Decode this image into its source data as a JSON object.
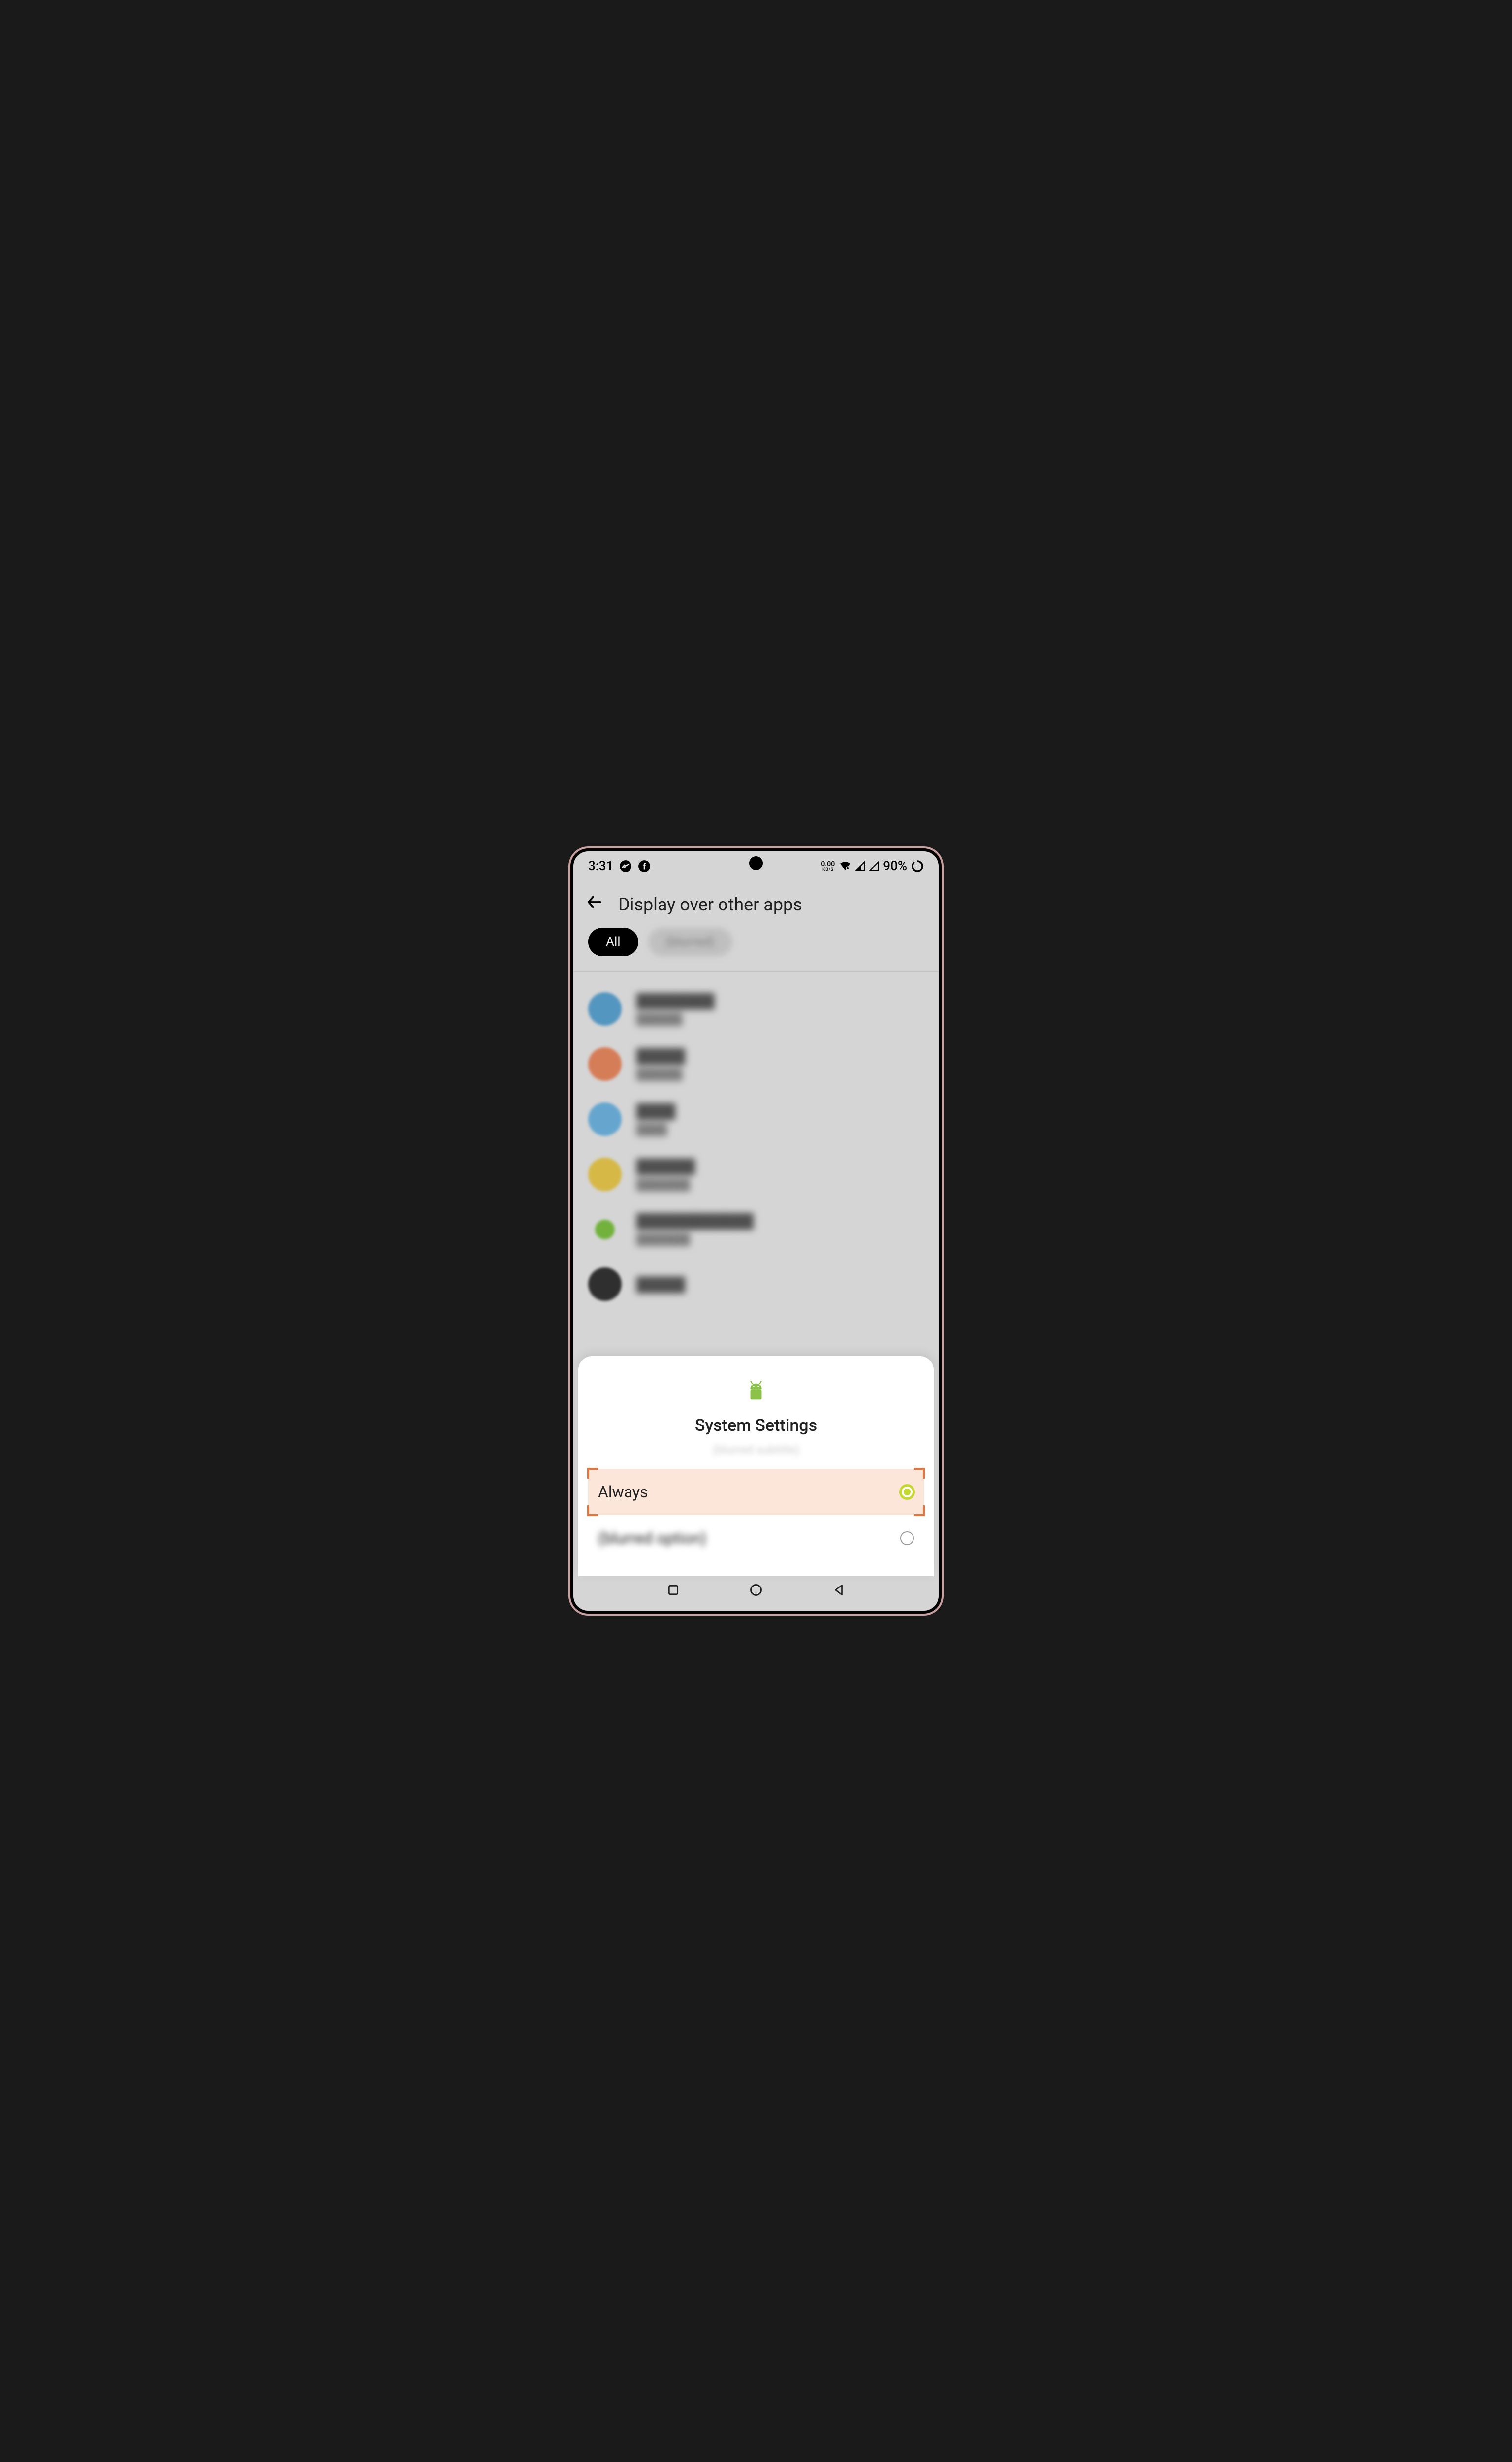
{
  "status": {
    "time": "3:31",
    "data_top": "0.00",
    "data_bottom": "KB/S",
    "battery_pct": "90%"
  },
  "header": {
    "title": "Display over other apps"
  },
  "chips": {
    "all": "All",
    "other": "(blurred)"
  },
  "sheet": {
    "title": "System Settings",
    "subtitle": "(blurred subtitle)",
    "option_always": "Always",
    "option_other": "(blurred option)"
  }
}
